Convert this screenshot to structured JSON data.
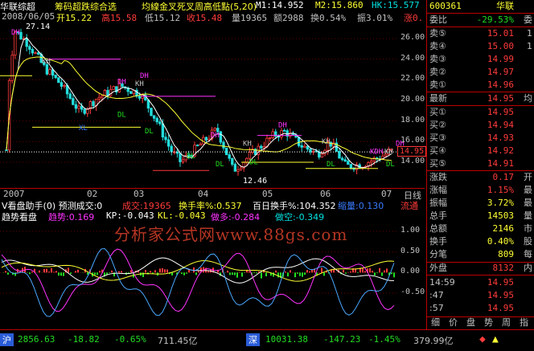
{
  "header": {
    "stock_name": "华联综超",
    "indicator_title": "筹码超跌综合选",
    "ma_label": "均線金叉死叉周高低點(5,20)",
    "m1": "M1:14.952",
    "m2": "M2:15.860",
    "hk": "HK:15.577",
    "right_code": "600361",
    "right_name": "华联"
  },
  "info_row": {
    "date": "2008/06/05",
    "open": "开15.22",
    "high": "高15.58",
    "low": "低15.12",
    "close": "收15.48",
    "volume": "量19365",
    "amount": "额2988",
    "turnover": "换0.54%",
    "amplitude": "振3.01%",
    "rise": "涨0."
  },
  "price_axis": [
    "26.00",
    "24.00",
    "22.00",
    "20.00",
    "18.00",
    "16.00",
    "14.00"
  ],
  "price_tag": "14.95",
  "annotations": {
    "high_mark": "27.14",
    "low_mark": "12.46"
  },
  "time_axis": {
    "labels": [
      "2007",
      "02",
      "03",
      "04",
      "05",
      "06",
      "07"
    ],
    "period": "日线"
  },
  "vol_row": {
    "title": "V看盘助手(0) 预测成交:0",
    "vol": "成交:19365",
    "rate": "换手率%:0.537",
    "hundred": "百日换手%:104.352",
    "shrink": "缩量:0.130",
    "flow": "流通"
  },
  "trend_row": {
    "title": "趋势看盘",
    "trend": "趋势:0.169",
    "kp": "KP:-0.043",
    "kl": "KL:-0.043",
    "long": "做多:-0.284",
    "short": "做空:-0.349"
  },
  "sub_axis": [
    "1.00",
    "0.50",
    "0.00",
    "-0.50"
  ],
  "watermark": "分析家公式网www.88gs.com",
  "right_panel": {
    "weibi_label": "委比",
    "weibi_val": "-29.53%",
    "weibi_ext": "委",
    "sells": [
      {
        "label": "卖⑤",
        "price": "15.01",
        "ext": "1"
      },
      {
        "label": "卖④",
        "price": "15.00",
        "ext": "1"
      },
      {
        "label": "卖③",
        "price": "14.99",
        "ext": ""
      },
      {
        "label": "卖②",
        "price": "14.97",
        "ext": ""
      },
      {
        "label": "卖①",
        "price": "14.96",
        "ext": ""
      }
    ],
    "latest_label": "最新",
    "latest_val": "14.95",
    "latest_ext": "均",
    "buys": [
      {
        "label": "买①",
        "price": "14.95",
        "ext": ""
      },
      {
        "label": "买②",
        "price": "14.94",
        "ext": ""
      },
      {
        "label": "买③",
        "price": "14.93",
        "ext": ""
      },
      {
        "label": "买④",
        "price": "14.92",
        "ext": ""
      },
      {
        "label": "买⑤",
        "price": "14.91",
        "ext": ""
      }
    ],
    "stats": [
      {
        "label": "涨跌",
        "val": "0.17",
        "ext": "开"
      },
      {
        "label": "涨幅",
        "val": "1.15%",
        "ext": "最"
      },
      {
        "label": "振幅",
        "val": "3.72%",
        "ext": "最"
      },
      {
        "label": "总手",
        "val": "14503",
        "ext": "量"
      },
      {
        "label": "总额",
        "val": "2146",
        "ext": "市"
      },
      {
        "label": "换手",
        "val": "0.40%",
        "ext": "股"
      },
      {
        "label": "分笔",
        "val": "809",
        "ext": "每"
      }
    ],
    "outer_label": "外盘",
    "outer_val": "8132",
    "outer_ext": "内",
    "ticks": [
      {
        "time": "14:59",
        "price": "14.95",
        "ext": ""
      },
      {
        "time": ":47",
        "price": "14.95",
        "ext": ""
      },
      {
        "time": ":57",
        "price": "14.95",
        "ext": ""
      }
    ],
    "tabs": [
      "细",
      "价",
      "盘",
      "势",
      "周",
      "指"
    ]
  },
  "status": {
    "sh_label": "沪",
    "sh_index": "2856.63",
    "sh_chg": "-18.82",
    "sh_pct": "-0.65%",
    "sh_amt": "711.45亿",
    "sz_label": "深",
    "sz_index": "10031.38",
    "sz_chg": "-147.23",
    "sz_pct": "-1.45%",
    "sz_amt": "379.99亿"
  },
  "colors": {
    "up": "#ff3b3b",
    "down": "#22dd22",
    "ma1": "#ffffff",
    "ma2": "#ffff33",
    "hk": "#00e0e0",
    "grid": "#aa0000"
  }
}
